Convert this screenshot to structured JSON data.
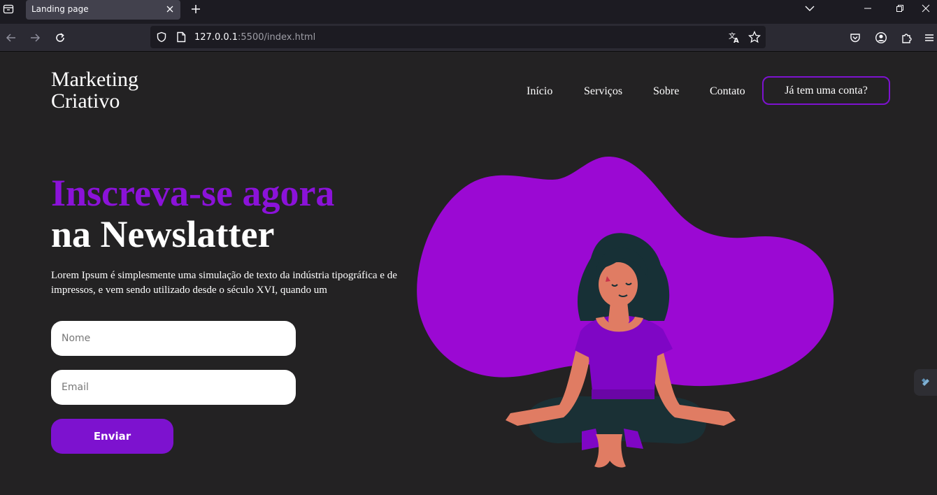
{
  "browser": {
    "tab_title": "Landing page",
    "url_host": "127.0.0.1",
    "url_rest": ":5500/index.html"
  },
  "header": {
    "logo_line1": "Marketing",
    "logo_line2": "Criativo",
    "nav": [
      "Início",
      "Serviços",
      "Sobre",
      "Contato"
    ],
    "login_label": "Já tem uma conta?"
  },
  "hero": {
    "headline_accent": "Inscreva-se agora",
    "headline_main": "na Newslatter",
    "lead": "Lorem Ipsum é simplesmente uma simulação de texto da indústria tipográfica e de impressos, e vem sendo utilizado desde o século XVI, quando um"
  },
  "form": {
    "name_placeholder": "Nome",
    "email_placeholder": "Email",
    "submit_label": "Enviar"
  },
  "icons": {
    "tab_list": "tab-list-icon",
    "tab_close": "close-icon",
    "new_tab": "plus-icon",
    "back": "back-arrow-icon",
    "forward": "forward-arrow-icon",
    "reload": "reload-icon",
    "tracking": "shield-icon",
    "page_info": "page-icon",
    "translate": "translate-icon",
    "bookmark": "star-icon",
    "pocket": "pocket-icon",
    "account": "account-icon",
    "extensions": "puzzle-icon"
  },
  "colors": {
    "accent": "#7d12cf",
    "headline_accent": "#8b12d9",
    "blob": "#9b09d3",
    "background": "#232223"
  }
}
